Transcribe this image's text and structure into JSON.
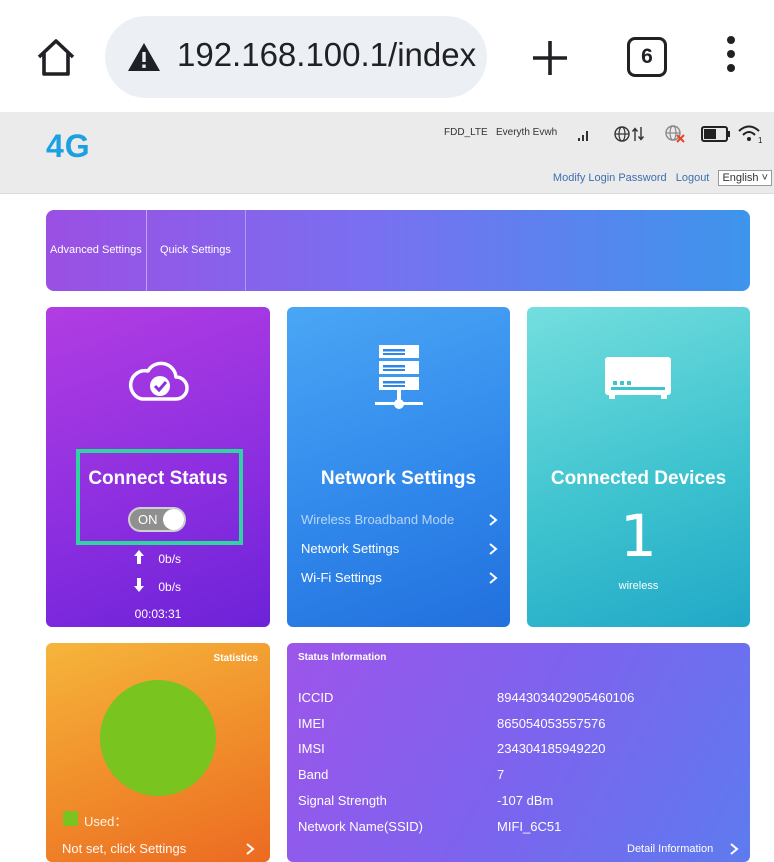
{
  "browser": {
    "url": "192.168.100.1/index",
    "tab_count": "6",
    "icons": [
      "home-icon",
      "warning-icon",
      "plus-icon",
      "tab-switcher-icon",
      "more-vertical-icon"
    ]
  },
  "header": {
    "logo": "4G",
    "network_type": "FDD_LTE",
    "operator": "Everyth Evwh",
    "links": {
      "modify_password": "Modify Login Password",
      "logout": "Logout"
    },
    "language": "English",
    "status_icons": [
      "signal-bars-icon",
      "internet-data-icon",
      "sim-error-icon",
      "battery-icon",
      "wifi-icon"
    ]
  },
  "menu": {
    "advanced_settings": "Advanced Settings",
    "quick_settings": "Quick Settings"
  },
  "connect_tile": {
    "title": "Connect Status",
    "toggle_label": "ON",
    "toggle_on": true,
    "upload_rate": "0b/s",
    "download_rate": "0b/s",
    "duration": "00:03:31",
    "icon": "cloud-check-icon"
  },
  "network_tile": {
    "title": "Network Settings",
    "icon": "server-network-icon",
    "links": [
      {
        "label": "Wireless Broadband Mode",
        "disabled": true
      },
      {
        "label": "Network Settings",
        "disabled": false
      },
      {
        "label": "Wi-Fi Settings",
        "disabled": false
      }
    ]
  },
  "devices_tile": {
    "title": "Connected Devices",
    "icon": "router-device-icon",
    "count": "1",
    "sub_label": "wireless"
  },
  "stats_tile": {
    "title": "Statistics",
    "used_label": "Used：",
    "not_set_label": "Not set, click Settings",
    "used_color": "#79c41e"
  },
  "status_info": {
    "title": "Status Information",
    "rows": [
      {
        "key": "ICCID",
        "value": "8944303402905460106"
      },
      {
        "key": "IMEI",
        "value": "865054053557576"
      },
      {
        "key": "IMSI",
        "value": "234304185949220"
      },
      {
        "key": "Band",
        "value": "7"
      },
      {
        "key": "Signal Strength",
        "value": "-107 dBm"
      },
      {
        "key": "Network Name(SSID)",
        "value": "MIFI_6C51"
      }
    ],
    "detail_link": "Detail Information"
  },
  "colors": {
    "logo": "#1ba0e2",
    "highlight": "#2fd4a1",
    "connect_tile": "#8d2fe0",
    "network_tile": "#2f86ea",
    "devices_tile": "#3ec3cf",
    "stats_tile": "#f08c2a",
    "status_tile": "#7d63ee"
  }
}
